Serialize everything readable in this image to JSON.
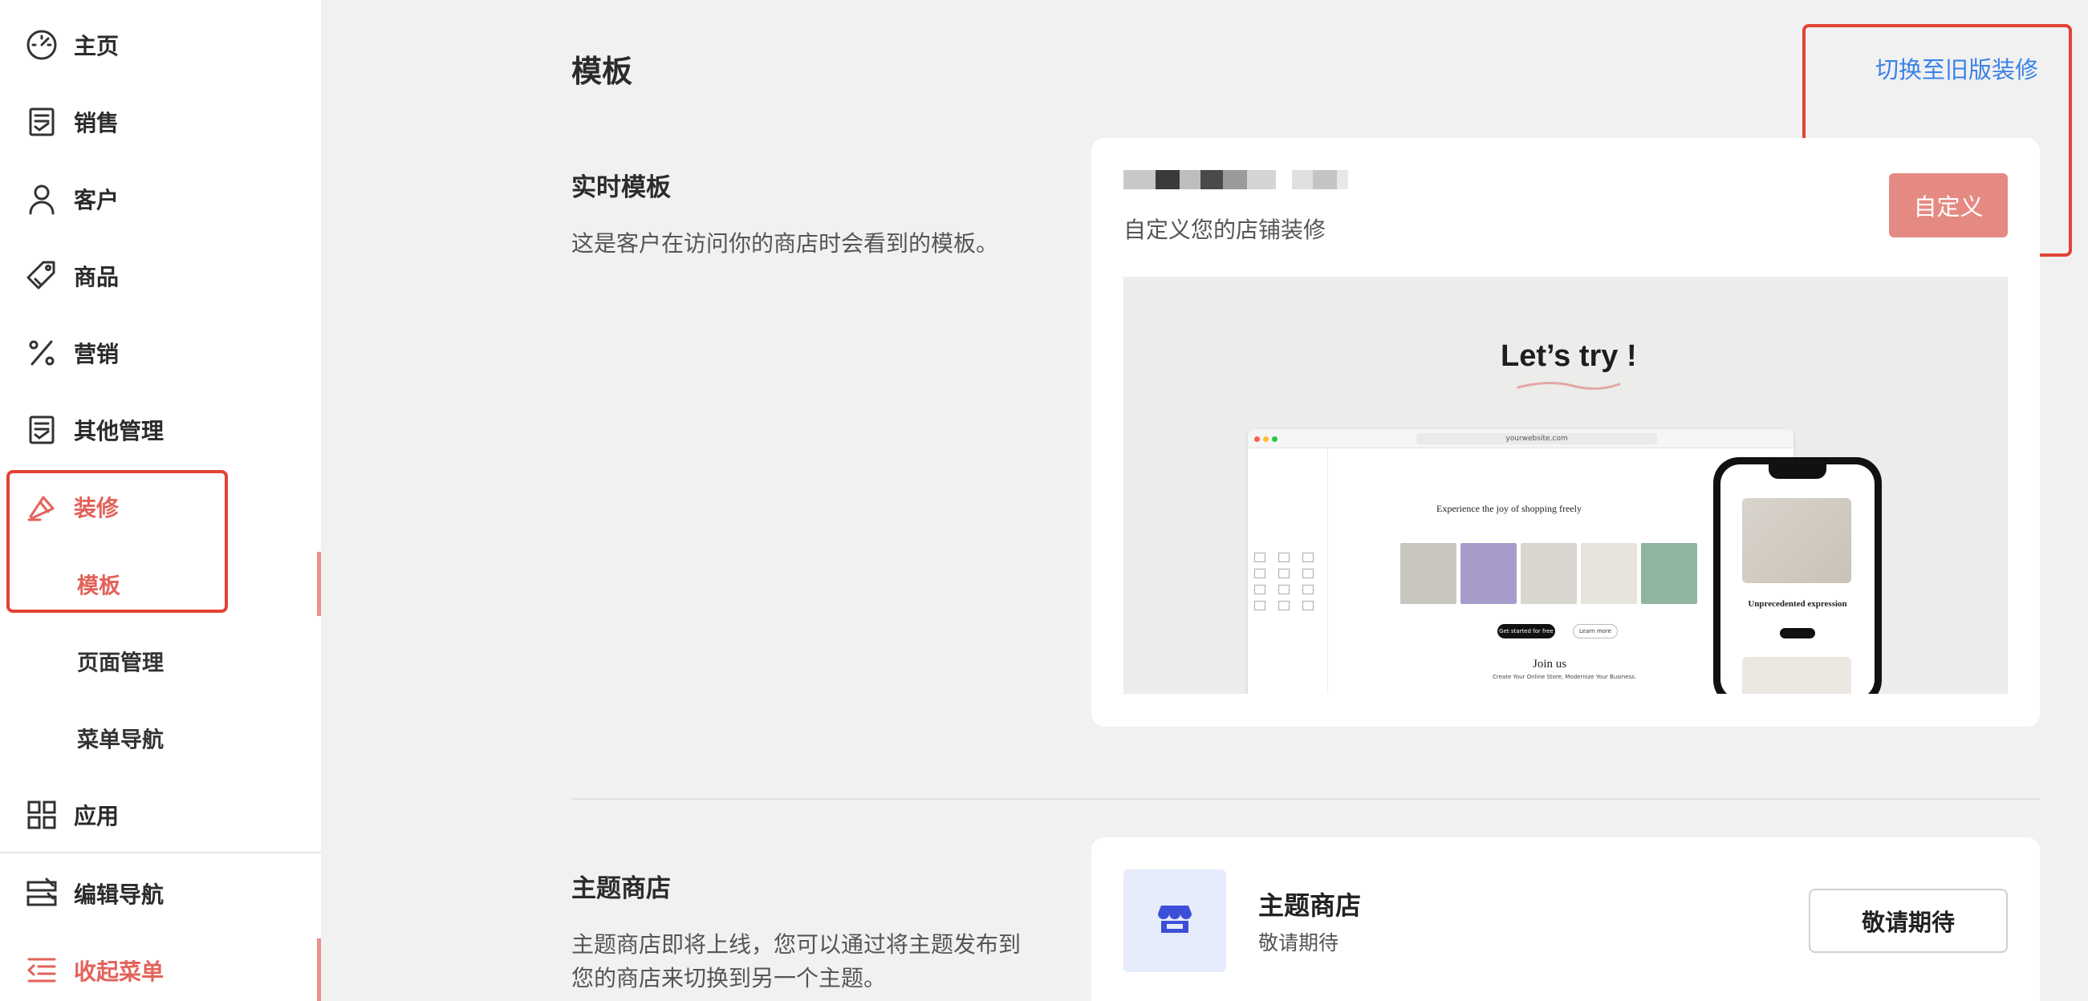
{
  "sidebar": {
    "items": [
      {
        "key": "home",
        "label": "主页",
        "icon": "dashboard-icon"
      },
      {
        "key": "sales",
        "label": "销售",
        "icon": "receipt-icon"
      },
      {
        "key": "customers",
        "label": "客户",
        "icon": "person-icon"
      },
      {
        "key": "products",
        "label": "商品",
        "icon": "tag-icon"
      },
      {
        "key": "marketing",
        "label": "营销",
        "icon": "percent-icon"
      },
      {
        "key": "other",
        "label": "其他管理",
        "icon": "receipt-icon"
      },
      {
        "key": "decoration",
        "label": "装修",
        "icon": "brush-icon",
        "active": true
      },
      {
        "key": "apps",
        "label": "应用",
        "icon": "grid-icon"
      },
      {
        "key": "edit_nav",
        "label": "编辑导航",
        "icon": "edit-nav-icon"
      },
      {
        "key": "collapse",
        "label": "收起菜单",
        "icon": "collapse-menu-icon"
      }
    ],
    "sub_items": [
      {
        "label": "模板",
        "active": true
      },
      {
        "label": "页面管理"
      },
      {
        "label": "菜单导航"
      }
    ]
  },
  "main": {
    "title": "模板",
    "switch_link": "切换至旧版装修",
    "live_template": {
      "title": "实时模板",
      "description": "这是客户在访问你的商店时会看到的模板。",
      "card_subtitle": "自定义您的店铺装修",
      "customize_button": "自定义",
      "preview": {
        "headline": "Let’s try !",
        "url": "yourwebsite.com",
        "heading": "Experience the joy of shopping freely",
        "primary_button": "Get started for free",
        "secondary_button": "Learn more",
        "join_title": "Join us",
        "join_sub": "Create Your Online Store, Modernize Your Business.",
        "phone_title": "Unprecedented expression"
      }
    },
    "theme_store": {
      "title": "主题商店",
      "description": "主题商店即将上线，您可以通过将主题发布到您的商店来切换到另一个主题。",
      "card_title": "主题商店",
      "card_sub": "敬请期待",
      "button": "敬请期待",
      "icon": "store-icon"
    }
  },
  "colors": {
    "accent": "#e3625a",
    "highlight": "#e34234",
    "link": "#3b82e8",
    "customize_bg": "#e58a82",
    "store_icon": "#3d4fd8"
  }
}
